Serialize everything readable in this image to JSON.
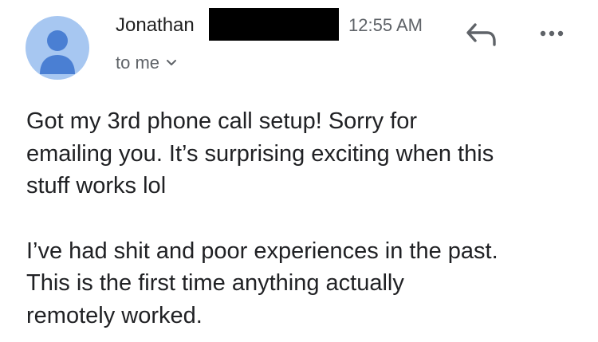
{
  "email": {
    "sender": "Jonathan",
    "time": "12:55 AM",
    "recipient_label": "to me",
    "avatar_icon": "person-avatar-icon",
    "avatar_color": "#a7c7f1",
    "avatar_figure_color": "#4a7fd3",
    "reply_icon": "reply-icon",
    "more_icon": "more-options-icon",
    "chevron_icon": "chevron-down-icon"
  },
  "body": {
    "paragraphs": [
      "Got my 3rd phone call setup! Sorry for\nemailing you. It’s surprising exciting when this\nstuff works lol",
      "I’ve had shit and poor experiences in the past.\nThis is the first time anything actually\nremotely worked."
    ]
  }
}
